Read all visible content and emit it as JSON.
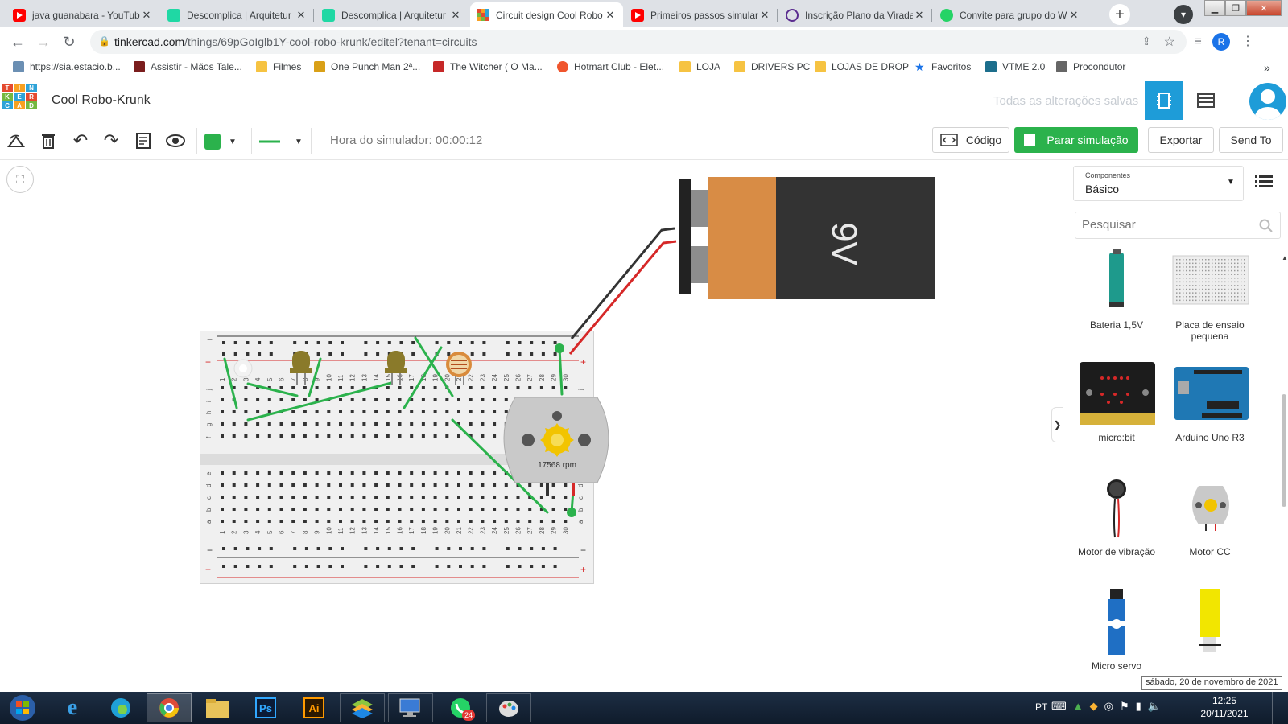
{
  "browser": {
    "tabs": [
      {
        "title": "java guanabara - YouTub",
        "icon": "youtube-icon",
        "color": "#ff0000"
      },
      {
        "title": "Descomplica | Arquitetur",
        "icon": "descomplica-icon",
        "color": "#1fd8a4"
      },
      {
        "title": "Descomplica | Arquitetur",
        "icon": "descomplica-icon",
        "color": "#1fd8a4"
      },
      {
        "title": "Circuit design Cool Robo",
        "icon": "tinkercad-icon",
        "color": "#e44a2f"
      },
      {
        "title": "Primeiros passos simular",
        "icon": "youtube-icon",
        "color": "#ff0000"
      },
      {
        "title": "Inscrição Plano da Virada",
        "icon": "circle-icon",
        "color": "#5b2d90"
      },
      {
        "title": "Convite para grupo do W",
        "icon": "whatsapp-icon",
        "color": "#25d366"
      }
    ],
    "url_host": "tinkercad.com",
    "url_path": "/things/69pGoIglb1Y-cool-robo-krunk/editel?tenant=circuits",
    "profile_initial": "R",
    "bookmarks": [
      {
        "label": "https://sia.estacio.b...",
        "color": "#6b8fb3"
      },
      {
        "label": "Assistir - Mãos Tale...",
        "color": "#7a1d1d"
      },
      {
        "label": "Filmes",
        "color": "#f6c342"
      },
      {
        "label": "One Punch Man 2ª...",
        "color": "#d9a017"
      },
      {
        "label": "The Witcher ( O Ma...",
        "color": "#c62828"
      },
      {
        "label": "Hotmart Club - Elet...",
        "color": "#f0552d"
      },
      {
        "label": "LOJA",
        "color": "#f6c342"
      },
      {
        "label": "DRIVERS PC",
        "color": "#f6c342"
      },
      {
        "label": "LOJAS DE DROP",
        "color": "#f6c342"
      },
      {
        "label": "Favoritos",
        "color": "#1a73e8"
      },
      {
        "label": "VTME 2.0",
        "color": "#1c6e8c"
      },
      {
        "label": "Procondutor",
        "color": "#666666"
      }
    ],
    "bookmarks_more": "»"
  },
  "tinkercad": {
    "logo_letters": [
      "T",
      "I",
      "N",
      "K",
      "E",
      "R",
      "C",
      "A",
      "D"
    ],
    "design_name": "Cool Robo-Krunk",
    "save_status": "Todas as alterações salvas",
    "simulator_time": "Hora do simulador: 00:00:12",
    "code_label": "Código",
    "stop_sim_label": "Parar simulação",
    "export_label": "Exportar",
    "send_to_label": "Send To",
    "wire_color": "#2bb24c",
    "battery_label": "9V",
    "motor_rpm": "17568 rpm",
    "panel": {
      "components_caption": "Componentes",
      "components_value": "Básico",
      "search_placeholder": "Pesquisar",
      "items": [
        {
          "label": "Bateria 1,5V"
        },
        {
          "label": "Placa de ensaio pequena"
        },
        {
          "label": "micro:bit"
        },
        {
          "label": "Arduino Uno R3"
        },
        {
          "label": "Motor de vibração"
        },
        {
          "label": "Motor CC"
        },
        {
          "label": "Micro servo"
        },
        {
          "label": ""
        }
      ]
    },
    "collapse_arrow": "❯"
  },
  "taskbar": {
    "language": "PT",
    "time": "12:25",
    "date": "20/11/2021",
    "tooltip": "sábado, 20 de novembro de 2021",
    "whatsapp_badge": "24"
  },
  "breadboard": {
    "columns_top": [
      "1",
      "2",
      "3",
      "4",
      "5",
      "6",
      "7",
      "8",
      "9",
      "10",
      "11",
      "12",
      "13",
      "14",
      "15",
      "16",
      "17",
      "18",
      "19",
      "20",
      "21",
      "22",
      "23",
      "24",
      "25",
      "26",
      "27",
      "28",
      "29",
      "30"
    ],
    "rows_top": [
      "j",
      "i",
      "h",
      "g",
      "f"
    ],
    "rows_bottom": [
      "e",
      "d",
      "c",
      "b",
      "a"
    ]
  }
}
